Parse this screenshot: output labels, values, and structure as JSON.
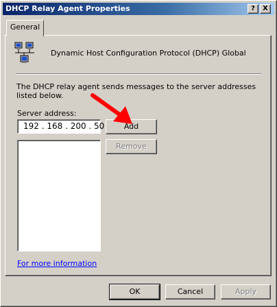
{
  "window": {
    "title": "DHCP Relay Agent Properties",
    "help_button": "?",
    "close_button": "X"
  },
  "tabs": [
    {
      "label": "General",
      "selected": true
    }
  ],
  "general": {
    "header_text": "Dynamic Host Configuration Protocol (DHCP) Global",
    "icon": "network-computers-icon",
    "description": "The DHCP relay agent sends messages to the server addresses listed below.",
    "server_address_label": "Server address:",
    "server_address_value": "192 . 168 . 200 .  50",
    "add_button": "Add",
    "remove_button": "Remove",
    "server_list": [],
    "more_info_link": "For more information"
  },
  "footer": {
    "ok": "OK",
    "cancel": "Cancel",
    "apply": "Apply"
  },
  "colors": {
    "face": "#d4d0c8",
    "title_start": "#0a246a",
    "title_end": "#a6caf0",
    "link": "#0000ff",
    "annotation_arrow": "#ff0000"
  }
}
